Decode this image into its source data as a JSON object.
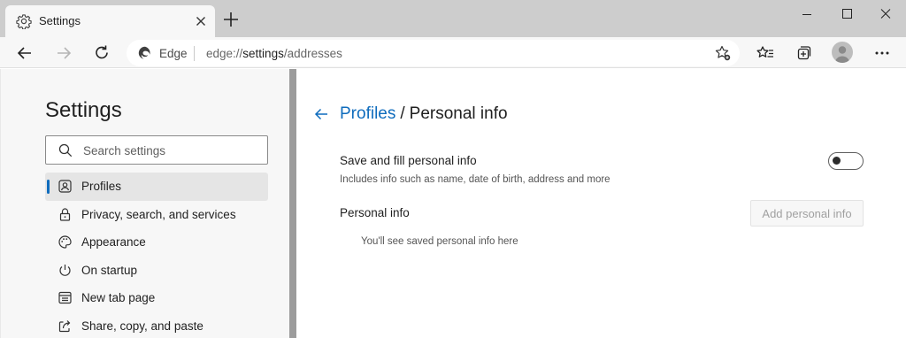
{
  "tab": {
    "title": "Settings",
    "icon": "gear-icon"
  },
  "toolbar": {
    "back_icon": "back-arrow-icon",
    "forward_icon": "forward-arrow-icon",
    "refresh_icon": "refresh-icon",
    "edge_label": "Edge",
    "url_scheme": "edge://",
    "url_host": "settings",
    "url_path": "/addresses",
    "right_icons": [
      "add-favorite-icon",
      "favorites-icon",
      "collections-icon",
      "profile-avatar",
      "more-icon"
    ]
  },
  "sidebar": {
    "title": "Settings",
    "search_placeholder": "Search settings",
    "items": [
      {
        "label": "Profiles",
        "icon": "profile-icon",
        "active": true
      },
      {
        "label": "Privacy, search, and services",
        "icon": "lock-icon",
        "active": false
      },
      {
        "label": "Appearance",
        "icon": "palette-icon",
        "active": false
      },
      {
        "label": "On startup",
        "icon": "power-icon",
        "active": false
      },
      {
        "label": "New tab page",
        "icon": "new-tab-page-icon",
        "active": false
      },
      {
        "label": "Share, copy, and paste",
        "icon": "share-icon",
        "active": false
      }
    ]
  },
  "main": {
    "breadcrumb_parent": "Profiles",
    "breadcrumb_separator": "/",
    "breadcrumb_current": "Personal info",
    "save_fill_title": "Save and fill personal info",
    "save_fill_desc": "Includes info such as name, date of birth, address and more",
    "save_fill_enabled": false,
    "personal_info_title": "Personal info",
    "add_button_label": "Add personal info",
    "empty_message": "You'll see saved personal info here"
  },
  "colors": {
    "accent": "#0f6cbd",
    "tab_strip": "#cdcdcd",
    "sidebar_bg": "#f7f7f7"
  }
}
